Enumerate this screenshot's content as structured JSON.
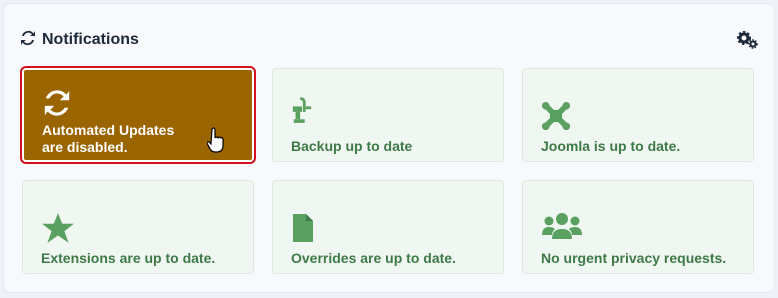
{
  "module": {
    "title": "Notifications",
    "title_icon": "sync-icon",
    "options_icon": "gears-icon"
  },
  "tiles": [
    {
      "label": "Automated Updates are disabled.",
      "icon": "sync-icon",
      "status": "warning",
      "color": "#9a6400"
    },
    {
      "label": "Backup up to date",
      "icon": "backup-icon",
      "status": "ok",
      "color": "#3d7a47"
    },
    {
      "label": "Joomla is up to date.",
      "icon": "joomla-logo-icon",
      "status": "ok",
      "color": "#3d7a47"
    },
    {
      "label": "Extensions are up to date.",
      "icon": "star-icon",
      "status": "ok",
      "color": "#3d7a47"
    },
    {
      "label": "Overrides are up to date.",
      "icon": "file-icon",
      "status": "ok",
      "color": "#3d7a47"
    },
    {
      "label": "No urgent privacy requests.",
      "icon": "users-icon",
      "status": "ok",
      "color": "#3d7a47"
    }
  ]
}
